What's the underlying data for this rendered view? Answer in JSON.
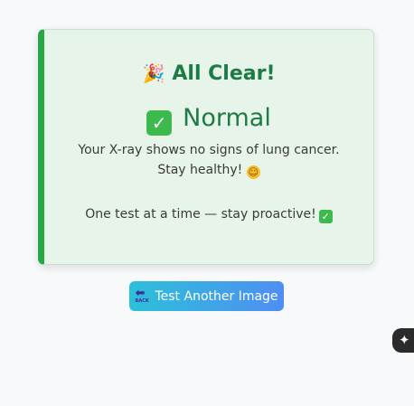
{
  "result": {
    "emoji": "🎉",
    "title": "All Clear!",
    "status_check": "✓",
    "status": "Normal",
    "message": "Your X-ray shows no signs of lung cancer. Stay healthy!",
    "message_emoji": "☺",
    "tagline": "One test at a time — stay proactive!",
    "tagline_check": "✓"
  },
  "actions": {
    "retry_label": "Test Another Image",
    "retry_icon_arrow": "⬅",
    "retry_icon_text": "BACK"
  },
  "floating": {
    "icon": "✦"
  },
  "colors": {
    "accent": "#28a745",
    "card_bg": "#e6f4ea",
    "title": "#1e7b45",
    "button_gradient_start": "#2cc0d9",
    "button_gradient_end": "#4f8ef2"
  }
}
